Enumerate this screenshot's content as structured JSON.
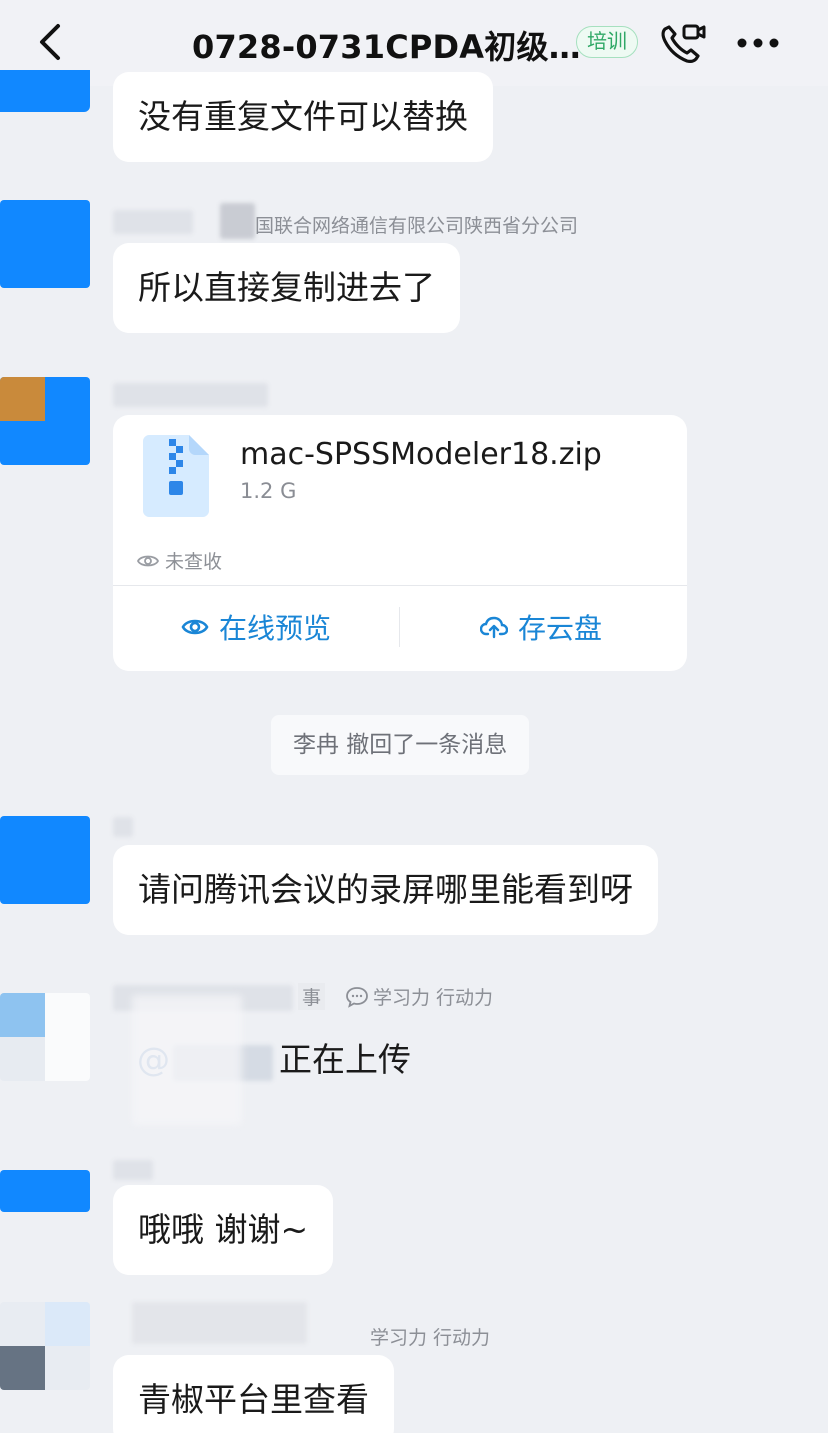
{
  "header": {
    "title": "0728-0731CPDA初级…",
    "tag": "培训"
  },
  "messages": [
    {
      "text": "没有重复文件可以替换"
    },
    {
      "sender_org": "国联合网络通信有限公司陕西省分公司",
      "text": "所以直接复制进去了"
    },
    {
      "file": {
        "name": "mac-SPSSModeler18.zip",
        "size": "1.2 G",
        "status": "未查收",
        "preview_label": "在线预览",
        "save_label": "存云盘"
      }
    },
    {
      "system": "李冉 撤回了一条消息"
    },
    {
      "text": "请问腾讯会议的录屏哪里能看到呀"
    },
    {
      "sender_suffix": "事",
      "badges": "学习力 行动力",
      "text": "正在上传",
      "mention": "@"
    },
    {
      "text": "哦哦 谢谢~"
    },
    {
      "badges": "学习力 行动力",
      "text": "青椒平台里查看"
    }
  ],
  "colors": {
    "background": "#eef0f4",
    "bubble": "#ffffff",
    "accent": "#1a86d6",
    "tag_green": "#2fa866"
  },
  "icons": {
    "back": "chevron-left-icon",
    "call": "phone-video-icon",
    "more": "ellipsis-icon",
    "file": "zip-file-icon",
    "eye": "eye-icon",
    "cloud": "cloud-upload-icon"
  }
}
